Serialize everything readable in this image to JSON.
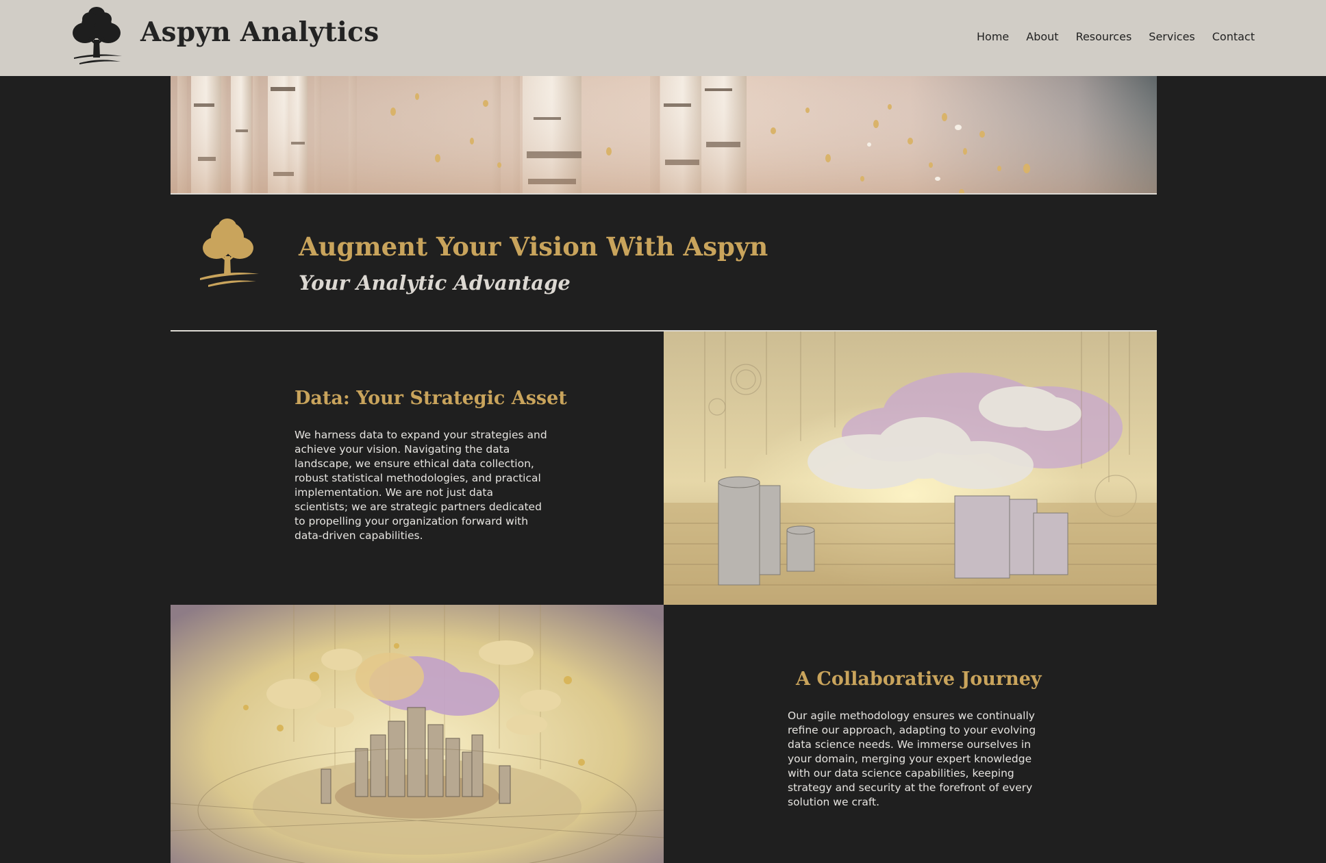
{
  "header": {
    "brand": "Aspyn Analytics",
    "nav": [
      "Home",
      "About",
      "Resources",
      "Services",
      "Contact"
    ]
  },
  "intro": {
    "title": "Augment Your Vision With Aspyn",
    "subtitle": "Your Analytic Advantage"
  },
  "features": [
    {
      "heading": "Data: Your Strategic Asset",
      "body": "We harness data to expand your strategies and achieve your vision. Navigating the data landscape, we ensure ethical data collection, robust statistical methodologies, and practical implementation. We are not just data scientists; we are strategic partners dedicated to propelling your organization forward with data-driven capabilities."
    },
    {
      "heading": "A Collaborative Journey",
      "body": "Our agile methodology ensures we continually refine our approach, adapting to your evolving data science needs. We immerse ourselves in your domain, merging your expert knowledge with our data science capabilities, keeping strategy and security at the forefront of every solution we craft."
    }
  ],
  "colors": {
    "header_bg": "#d1cdc6",
    "page_bg": "#1f1f1f",
    "accent_gold": "#c9a45c",
    "text_light": "#e6e4e0"
  },
  "icons": [
    "aspen-tree-logo-dark",
    "aspen-tree-logo-gold"
  ]
}
